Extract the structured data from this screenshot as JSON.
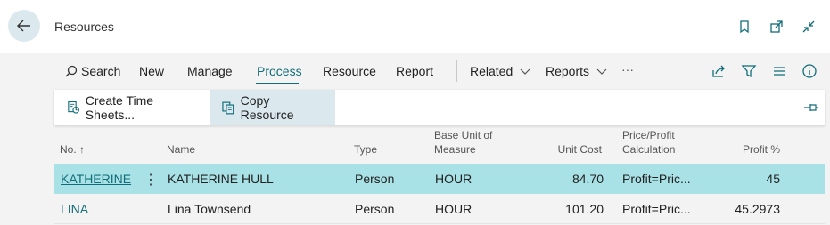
{
  "window": {
    "title": "Resources"
  },
  "actions": {
    "search": "Search",
    "new": "New",
    "manage": "Manage",
    "process": "Process",
    "resource": "Resource",
    "report": "Report",
    "related": "Related",
    "reports": "Reports",
    "more": "···"
  },
  "process_menu": {
    "create_time_sheets": "Create Time Sheets...",
    "copy_resource": "Copy Resource"
  },
  "table": {
    "headers": {
      "no": "No. ↑",
      "name": "Name",
      "type": "Type",
      "base_unit_1": "Base Unit of",
      "base_unit_2": "Measure",
      "unit_cost": "Unit Cost",
      "calc_1": "Price/Profit",
      "calc_2": "Calculation",
      "profit": "Profit %"
    },
    "rows": [
      {
        "no": "KATHERINE",
        "name": "KATHERINE HULL",
        "type": "Person",
        "unit": "HOUR",
        "unit_cost": "84.70",
        "calc": "Profit=Pric...",
        "profit": "45"
      },
      {
        "no": "LINA",
        "name": "Lina Townsend",
        "type": "Person",
        "unit": "HOUR",
        "unit_cost": "101.20",
        "calc": "Profit=Pric...",
        "profit": "45.2973"
      }
    ]
  },
  "icons": {
    "back": "arrow-left-icon",
    "bookmark": "bookmark-icon",
    "open_new": "open-in-new-window-icon",
    "collapse": "collapse-icon",
    "share": "share-icon",
    "filter": "filter-icon",
    "list": "list-view-icon",
    "info": "info-icon",
    "pin": "pin-icon"
  },
  "colors": {
    "accent": "#106d79",
    "selected_row": "#a9e2e6",
    "highlight": "#dbe9ef"
  }
}
